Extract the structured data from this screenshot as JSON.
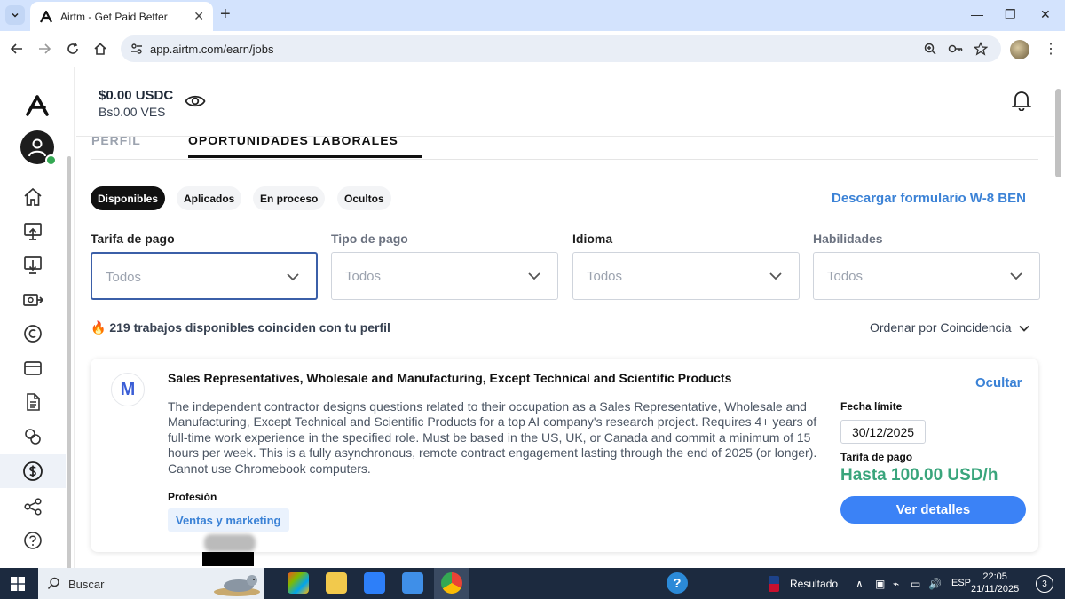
{
  "browser": {
    "tab_title": "Airtm - Get Paid Better",
    "url": "app.airtm.com/earn/jobs"
  },
  "balance": {
    "usdc": "$0.00 USDC",
    "ves": "Bs0.00 VES"
  },
  "page_tabs": {
    "profile": "PERFIL",
    "opportunities": "OPORTUNIDADES LABORALES"
  },
  "status_pills": [
    "Disponibles",
    "Aplicados",
    "En proceso",
    "Ocultos"
  ],
  "download_w8": "Descargar formulario W-8 BEN",
  "filters": [
    {
      "label": "Tarifa de pago",
      "value": "Todos"
    },
    {
      "label": "Tipo de pago",
      "value": "Todos"
    },
    {
      "label": "Idioma",
      "value": "Todos"
    },
    {
      "label": "Habilidades",
      "value": "Todos"
    }
  ],
  "results": {
    "count_text": "219 trabajos disponibles coinciden con tu perfil",
    "sort_text": "Ordenar por Coincidencia"
  },
  "job": {
    "company_initial": "M",
    "title": "Sales Representatives, Wholesale and Manufacturing, Except Technical and Scientific Products",
    "hide_label": "Ocultar",
    "description": "The independent contractor designs questions related to their occupation as a Sales Representative, Wholesale and Manufacturing, Except Technical and Scientific Products for a top AI company's research project. Requires 4+ years of full-time work experience in the specified role. Must be based in the US, UK, or Canada and commit a minimum of 15 hours per week. This is a fully asynchronous, remote contract engagement lasting through the end of 2025 (or longer). Cannot use Chromebook computers.",
    "profession_label": "Profesión",
    "profession": "Ventas y marketing",
    "deadline_label": "Fecha límite",
    "deadline": "30/12/2025",
    "rate_label": "Tarifa de pago",
    "rate": "Hasta 100.00 USD/h",
    "details_button": "Ver detalles"
  },
  "taskbar": {
    "search": "Buscar",
    "tray_label": "Resultado",
    "lang": "ESP",
    "time": "22:05",
    "date": "21/11/2025",
    "notifications": "3"
  },
  "colors": {
    "accent_blue": "#3b82f6",
    "link_blue": "#3b82d6",
    "rate_green": "#3aa57c",
    "chrome_tab_bg": "#d3e3fd",
    "taskbar": "#1c2a3f"
  }
}
